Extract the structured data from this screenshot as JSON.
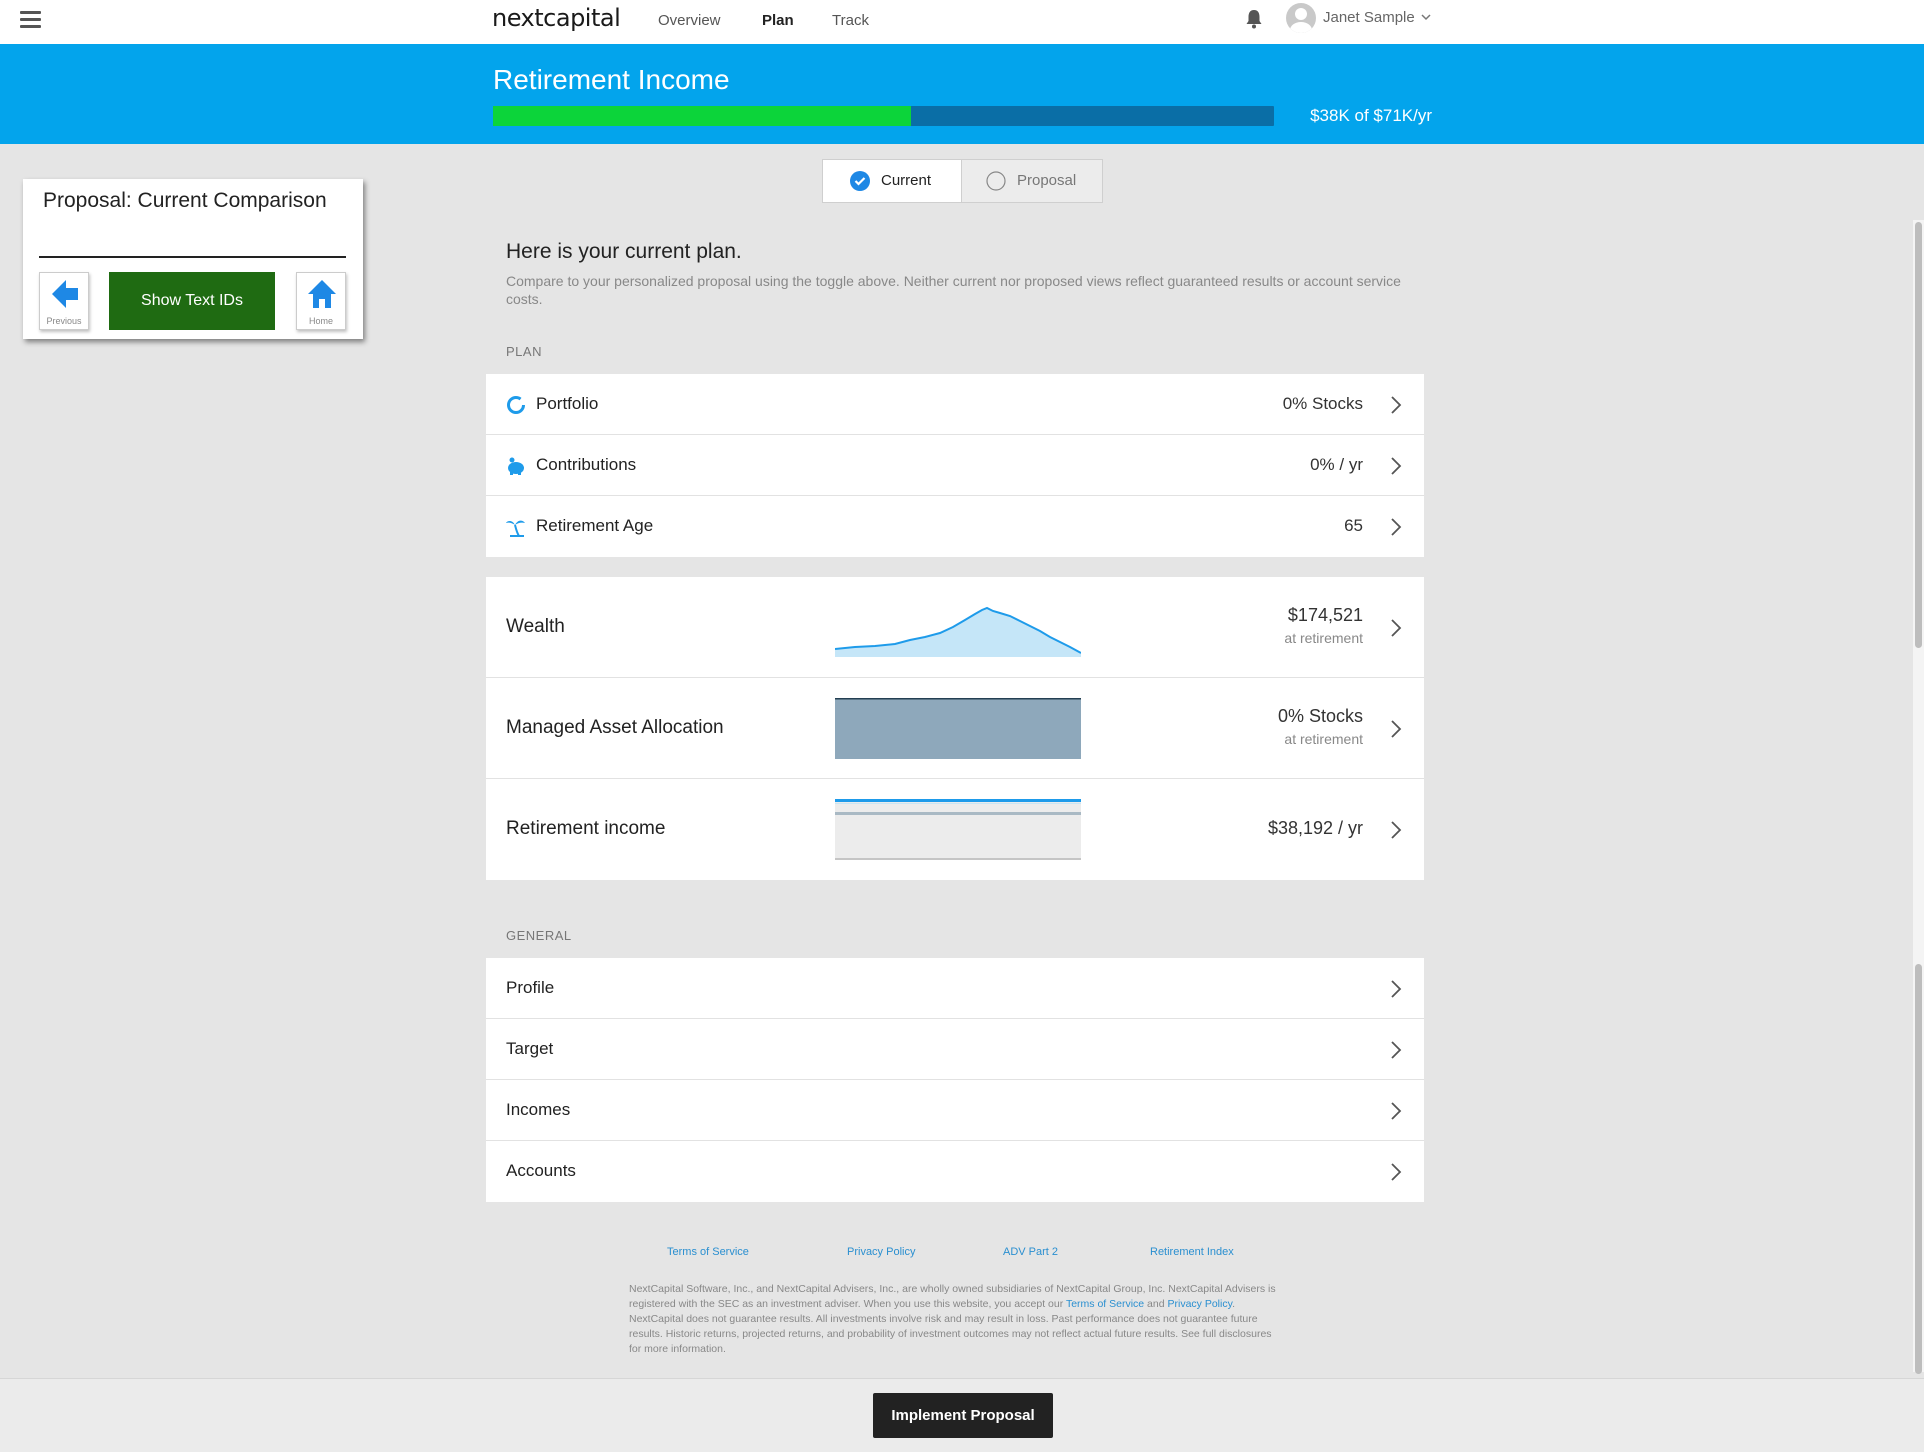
{
  "app": {
    "logo": "nextcapital",
    "nav": [
      {
        "label": "Overview"
      },
      {
        "label": "Plan"
      },
      {
        "label": "Track"
      }
    ],
    "user_name": "Janet Sample"
  },
  "hero": {
    "title": "Retirement Income",
    "progress_label": "$38K of $71K/yr",
    "progress_fraction": 0.535,
    "fill_color": "#0cd43a",
    "track_color": "#0a6ea6",
    "background": "#03a4ec"
  },
  "overlay": {
    "title": "Proposal: Current Comparison",
    "previous_label": "Previous",
    "show_ids_label": "Show Text IDs",
    "home_label": "Home"
  },
  "toggle": {
    "options": [
      {
        "label": "Current",
        "selected": true
      },
      {
        "label": "Proposal",
        "selected": false
      }
    ]
  },
  "intro": {
    "title": "Here is your current plan.",
    "text": "Compare to your personalized proposal using the toggle above. Neither current nor proposed views reflect guaranteed results or account service costs."
  },
  "plan": {
    "section_label": "PLAN",
    "rows": [
      {
        "label": "Portfolio",
        "value": "0% Stocks",
        "icon": "portfolio-ring-icon"
      },
      {
        "label": "Contributions",
        "value": "0% / yr",
        "icon": "piggy-bank-icon"
      },
      {
        "label": "Retirement Age",
        "value": "65",
        "icon": "palm-tree-icon"
      }
    ]
  },
  "summary": {
    "rows": [
      {
        "label": "Wealth",
        "value": "$174,521",
        "sub": "at retirement"
      },
      {
        "label": "Managed Asset Allocation",
        "value": "0% Stocks",
        "sub": "at retirement"
      },
      {
        "label": "Retirement income",
        "value": "$38,192 / yr",
        "sub": ""
      }
    ]
  },
  "general": {
    "section_label": "GENERAL",
    "rows": [
      {
        "label": "Profile"
      },
      {
        "label": "Target"
      },
      {
        "label": "Incomes"
      },
      {
        "label": "Accounts"
      }
    ]
  },
  "footer": {
    "links": [
      {
        "label": "Terms of Service"
      },
      {
        "label": "Privacy Policy"
      },
      {
        "label": "ADV Part 2"
      },
      {
        "label": "Retirement Index"
      }
    ],
    "disclaimer_part1": "NextCapital Software, Inc., and NextCapital Advisers, Inc., are wholly owned subsidiaries of NextCapital Group, Inc. NextCapital Advisers is registered with the SEC as an investment adviser. When you use this website, you accept our ",
    "disclaimer_link1": "Terms of Service",
    "disclaimer_part2": " and ",
    "disclaimer_link2": "Privacy Policy",
    "disclaimer_part3": ". NextCapital does not guarantee results. All investments involve risk and may result in loss. Past performance does not guarantee future results. Historic returns, projected returns, and probability of investment outcomes may not reflect actual future results. See full disclosures for more information."
  },
  "bottom": {
    "implement_label": "Implement Proposal"
  }
}
